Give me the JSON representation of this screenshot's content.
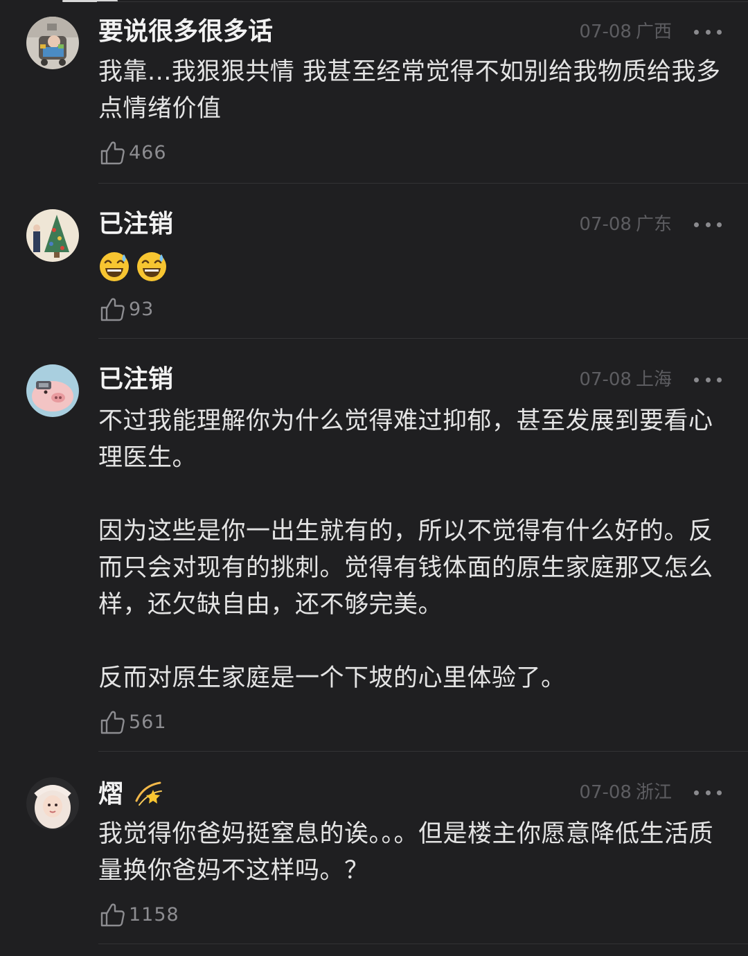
{
  "comments": [
    {
      "username": "要说很多很多话",
      "date": "07-08",
      "region": "广西",
      "paragraphs": [
        "我靠...我狠狠共情 我甚至经常觉得不如别给我物质给我多点情绪价值"
      ],
      "likes": "466"
    },
    {
      "username": "已注销",
      "date": "07-08",
      "region": "广东",
      "emojis": [
        "sweat-smile-emoji",
        "sweat-smile-emoji"
      ],
      "likes": "93"
    },
    {
      "username": "已注销",
      "date": "07-08",
      "region": "上海",
      "paragraphs": [
        "不过我能理解你为什么觉得难过抑郁，甚至发展到要看心理医生。",
        "因为这些是你一出生就有的，所以不觉得有什么好的。反而只会对现有的挑刺。觉得有钱体面的原生家庭那又怎么样，还欠缺自由，还不够完美。",
        "反而对原生家庭是一个下坡的心里体验了。"
      ],
      "likes": "561"
    },
    {
      "username": "熠",
      "username_icon": "dizzy-star-icon",
      "date": "07-08",
      "region": "浙江",
      "paragraphs": [
        "我觉得你爸妈挺窒息的诶。。。但是楼主你愿意降低生活质量换你爸妈不这样吗。？"
      ],
      "likes": "1158"
    }
  ],
  "colors": {
    "background": "#1f1f21",
    "username": "#f2f2f2",
    "body_text": "#e4e4e4",
    "meta_text": "#5d5d61",
    "like_text": "#8d8d91",
    "divider": "#333335"
  }
}
